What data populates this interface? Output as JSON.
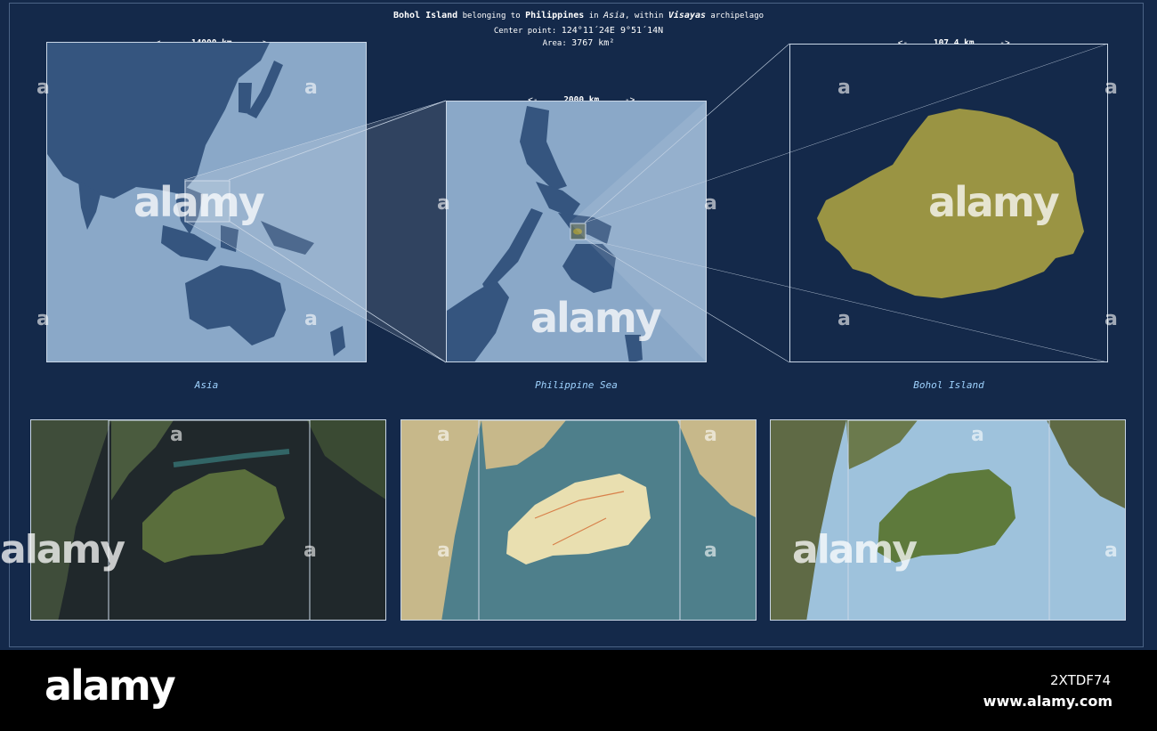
{
  "header": {
    "island": "Bohol Island",
    "t1": " belonging to ",
    "country": "Philippines",
    "t2": " in ",
    "continent": "Asia",
    "t3": ", within ",
    "archipelago": "Visayas",
    "t4": " archipelago",
    "center_label": "Center point: ",
    "center_value": "124°11´24E  9°51´14N",
    "area_label": "Area: ",
    "area_value": "3767 km²"
  },
  "panels": [
    {
      "scale_left": "<-",
      "scale": "14000 km",
      "scale_right": "->",
      "caption": "Asia"
    },
    {
      "scale_left": "<-",
      "scale": "2000 km",
      "scale_right": "->",
      "caption": "Philippine Sea"
    },
    {
      "scale_left": "<-",
      "scale": "107.4 km",
      "scale_right": "->",
      "caption": "Bohol Island"
    }
  ],
  "watermark": {
    "text": "alamy",
    "corner": "a"
  },
  "footer": {
    "brand": "alamy",
    "image_id": "2XTDF74",
    "url": "www.alamy.com"
  },
  "colors": {
    "background": "#14294a",
    "land_dark": "#35557f",
    "sea_light": "#8aa8c8",
    "highlight": "#9a9443",
    "caption": "#9fd3ff"
  }
}
